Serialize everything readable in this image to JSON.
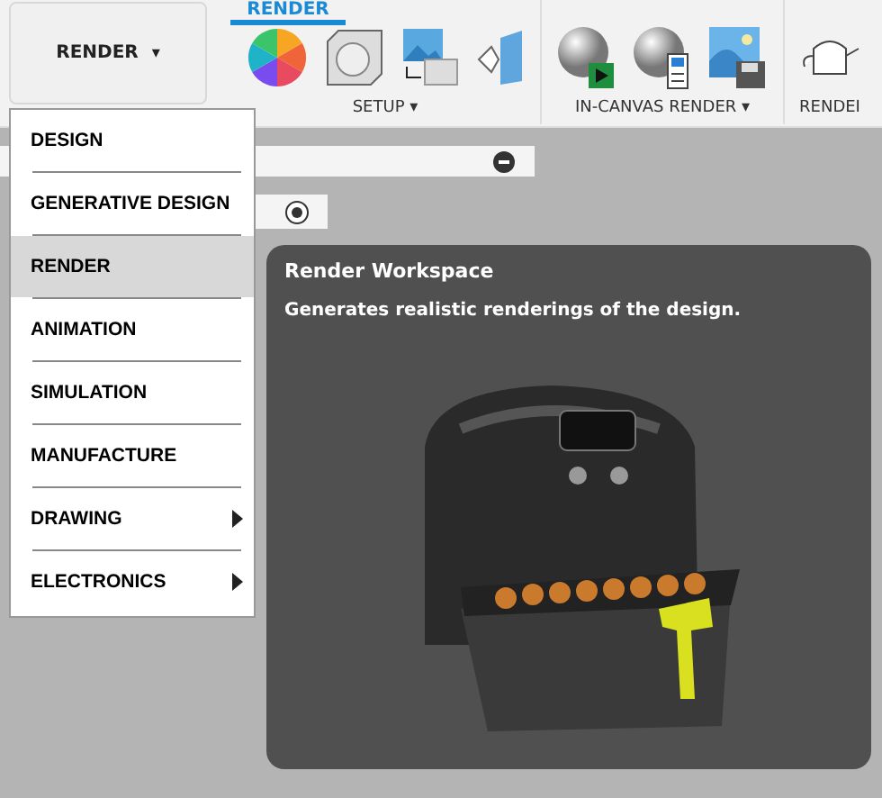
{
  "workspace_button": {
    "label": "RENDER",
    "caret": "▾"
  },
  "active_tab": {
    "label": "RENDER"
  },
  "toolbar_groups": [
    {
      "label": "SETUP",
      "caret": "▾"
    },
    {
      "label": "IN-CANVAS RENDER",
      "caret": "▾"
    },
    {
      "label": "RENDEI"
    }
  ],
  "workspace_menu": [
    {
      "label": "DESIGN",
      "selected": false,
      "submenu": false
    },
    {
      "label": "GENERATIVE DESIGN",
      "selected": false,
      "submenu": false
    },
    {
      "label": "RENDER",
      "selected": true,
      "submenu": false
    },
    {
      "label": "ANIMATION",
      "selected": false,
      "submenu": false
    },
    {
      "label": "SIMULATION",
      "selected": false,
      "submenu": false
    },
    {
      "label": "MANUFACTURE",
      "selected": false,
      "submenu": false
    },
    {
      "label": "DRAWING",
      "selected": false,
      "submenu": true
    },
    {
      "label": "ELECTRONICS",
      "selected": false,
      "submenu": true
    }
  ],
  "tooltip": {
    "title": "Render Workspace",
    "description": "Generates realistic renderings of the design."
  }
}
